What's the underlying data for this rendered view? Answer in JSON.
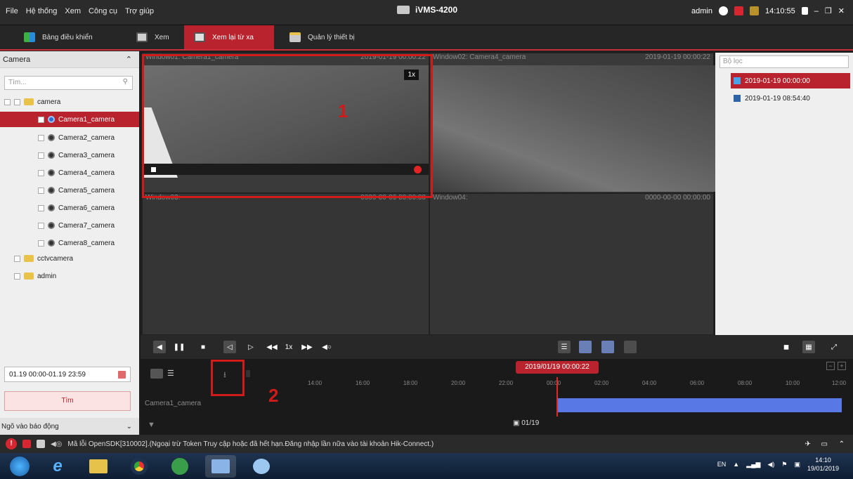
{
  "menu": [
    "File",
    "Hệ thống",
    "Xem",
    "Công cụ",
    "Trợ giúp"
  ],
  "app_title": "iVMS-4200",
  "topright": {
    "user": "admin",
    "time": "14:10:55"
  },
  "tabs": [
    {
      "label": "Bảng điều khiển",
      "icon": "dashboard-icon"
    },
    {
      "label": "Xem",
      "icon": "monitor-icon"
    },
    {
      "label": "Xem lại từ xa",
      "icon": "playback-icon"
    },
    {
      "label": "Quản lý thiết bị",
      "icon": "device-icon"
    }
  ],
  "sidebar": {
    "header": "Camera",
    "search_placeholder": "Tìm...",
    "root": "camera",
    "cameras": [
      "Camera1_camera",
      "Camera2_camera",
      "Camera3_camera",
      "Camera4_camera",
      "Camera5_camera",
      "Camera6_camera",
      "Camera7_camera",
      "Camera8_camera"
    ],
    "folders": [
      "cctvcamera",
      "admin"
    ],
    "date_range": "01.19 00:00-01.19 23:59",
    "find_label": "Tìm",
    "alarm_label": "Ngõ vào báo động"
  },
  "windows": [
    {
      "title": "Window01: Camera1_camera",
      "time": "2019-01-19 00:00:22",
      "speed": "1x"
    },
    {
      "title": "Window02: Camera4_camera",
      "time": "2019-01-19 00:00:22"
    },
    {
      "title": "Window03:",
      "time": "0000-00-00 00:00:00"
    },
    {
      "title": "Window04:",
      "time": "0000-00-00 00:00:00"
    }
  ],
  "annotations": {
    "one": "1",
    "two": "2"
  },
  "rightpanel": {
    "filter_placeholder": "Bộ lọc",
    "records": [
      "2019-01-19 00:00:00",
      "2019-01-19 08:54:40"
    ]
  },
  "controls": {
    "speed": "1x"
  },
  "timeline": {
    "current": "2019/01/19 00:00:22",
    "ticks": [
      "14:00",
      "16:00",
      "18:00",
      "20:00",
      "22:00",
      "00:00",
      "02:00",
      "04:00",
      "06:00",
      "08:00",
      "10:00",
      "12:00"
    ],
    "track": "Camera1_camera",
    "date": "01/19"
  },
  "status": {
    "message": "Mã lỗi OpenSDK[310002].(Ngoại trừ Token Truy cập hoặc đã hết hạn.Đăng nhập lần nữa vào tài khoản Hik-Connect.)"
  },
  "tray": {
    "lang": "EN",
    "time": "14:10",
    "date": "19/01/2019"
  },
  "colors": {
    "accent": "#b8232d",
    "record_bar": "#5878e6",
    "highlight": "#d11a1a"
  }
}
